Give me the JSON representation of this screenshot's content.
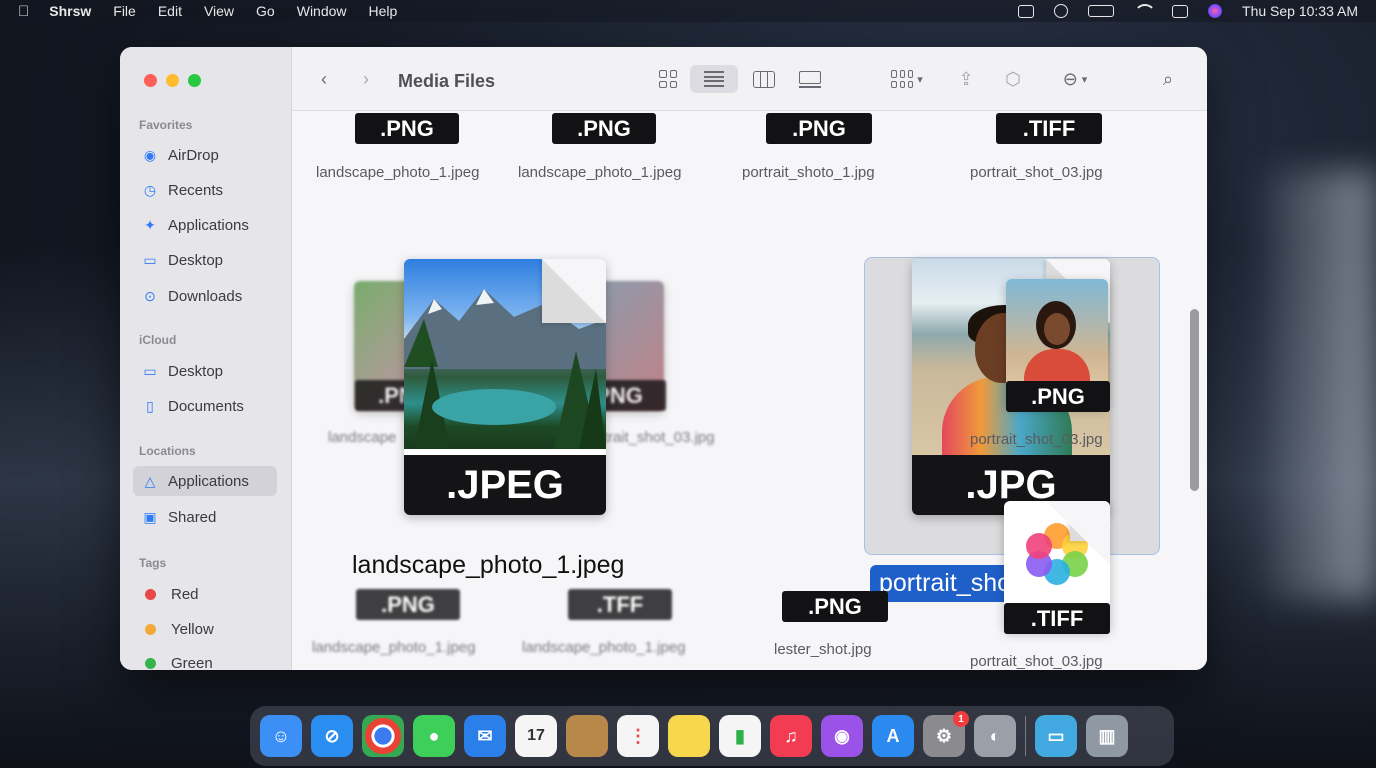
{
  "menubar": {
    "app_name": "Shrsw",
    "items": [
      "File",
      "Edit",
      "View",
      "Go",
      "Window",
      "Help"
    ],
    "clock": "Thu Sep  10:33 AM"
  },
  "window": {
    "title": "Media Files",
    "sidebar": {
      "favorites_header": "Favorites",
      "favorites": [
        {
          "label": "AirDrop",
          "icon": "airdrop-icon"
        },
        {
          "label": "Recents",
          "icon": "clock-icon"
        },
        {
          "label": "Applications",
          "icon": "applications-icon"
        },
        {
          "label": "Desktop",
          "icon": "desktop-icon"
        },
        {
          "label": "Downloads",
          "icon": "download-icon"
        }
      ],
      "icloud_header": "iCloud",
      "icloud": [
        {
          "label": "Desktop",
          "icon": "desktop-icon"
        },
        {
          "label": "Documents",
          "icon": "document-icon"
        }
      ],
      "locations_header": "Locations",
      "locations": [
        {
          "label": "Applications",
          "icon": "applications-icon",
          "selected": true
        },
        {
          "label": "Shared",
          "icon": "shared-icon"
        }
      ],
      "tags_header": "Tags",
      "tags": [
        {
          "label": "Red",
          "color": "#e94848"
        },
        {
          "label": "Yellow",
          "color": "#f2a93a"
        },
        {
          "label": "Green",
          "color": "#36b34a"
        }
      ]
    },
    "files": {
      "row1": [
        {
          "badge": ".PNG",
          "name": "landscape_photo_1.jpeg"
        },
        {
          "badge": ".PNG",
          "name": "landscape_photo_1.jpeg"
        },
        {
          "badge": ".PNG",
          "name": "portrait_shoto_1.jpg"
        },
        {
          "badge": ".TIFF",
          "name": "portrait_shot_03.jpg"
        }
      ],
      "row2_back": [
        {
          "badge": ".PNG",
          "name": "landscape"
        },
        {
          "badge": ".PNG",
          "name": "portrait_shot_03.jpg"
        },
        {
          "badge": ".PNG",
          "name": "portrait_shot_03.jpg"
        }
      ],
      "featured": [
        {
          "badge": ".JPEG",
          "name": "landscape_photo_1.jpeg"
        },
        {
          "badge": ".JPG",
          "name": "portrait_shot_03.jpg",
          "selected": true
        }
      ],
      "row3": [
        {
          "badge": ".PNG",
          "name": "landscape_photo_1.jpeg"
        },
        {
          "badge": ".TFF",
          "name": "landscape_photo_1.jpeg"
        },
        {
          "badge": ".PNG",
          "name": "lester_shot.jpg"
        },
        {
          "badge": ".TIFF",
          "name": "portrait_shot_03.jpg"
        }
      ]
    }
  },
  "dock": {
    "apps": [
      {
        "name": "finder-icon",
        "color": "#3b8ff5"
      },
      {
        "name": "safari-icon",
        "color": "#2a8ef0"
      },
      {
        "name": "chrome-icon",
        "color": "#e9e9ea"
      },
      {
        "name": "messages-icon",
        "color": "#3ecf5a"
      },
      {
        "name": "mail-icon",
        "color": "#2b7fe8"
      },
      {
        "name": "calendar-icon",
        "color": "#f5f5f5",
        "text": "17"
      },
      {
        "name": "contacts-icon",
        "color": "#b8884a"
      },
      {
        "name": "reminders-icon",
        "color": "#f5f5f5"
      },
      {
        "name": "notes-icon",
        "color": "#f7d74e"
      },
      {
        "name": "numbers-icon",
        "color": "#f5f5f5"
      },
      {
        "name": "music-icon",
        "color": "#f33c52"
      },
      {
        "name": "podcasts-icon",
        "color": "#9a52e8"
      },
      {
        "name": "appstore-icon",
        "color": "#2a8af0"
      },
      {
        "name": "settings-icon",
        "color": "#8a8a8f",
        "badge": "1"
      },
      {
        "name": "privacy-icon",
        "color": "#9aa0a8"
      },
      {
        "name": "folder-icon",
        "color": "#41a8e0"
      },
      {
        "name": "trash-icon",
        "color": "#9098a4"
      }
    ]
  }
}
